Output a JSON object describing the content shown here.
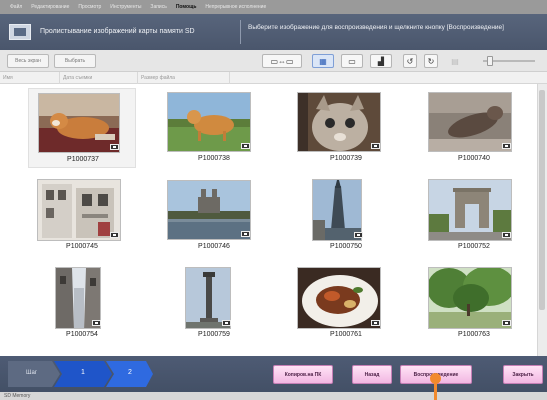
{
  "menu": {
    "items": [
      {
        "label": "Файл"
      },
      {
        "label": "Редактирование"
      },
      {
        "label": "Просмотр"
      },
      {
        "label": "Инструменты"
      },
      {
        "label": "Запись"
      },
      {
        "label": "Помощь",
        "active": true
      },
      {
        "label": "Непрерывное исполнение"
      }
    ]
  },
  "titlebar": {
    "title": "Пролистывание изображений карты памяти SD",
    "message": "Выберите изображение для воспроизведения и щелкните кнопку [Воспроизведение]"
  },
  "toolbar": {
    "left_buttons": [
      {
        "label": "Весь экран",
        "icon": "fullscreen"
      },
      {
        "label": "Выбрать",
        "icon": "select"
      }
    ],
    "view_icons": [
      {
        "icon": "copy-to-pc-icon",
        "glyph": "▭⇔▭"
      },
      {
        "icon": "thumbnail-view-icon",
        "glyph": "▦",
        "active": true
      },
      {
        "icon": "single-view-icon",
        "glyph": "▭"
      },
      {
        "icon": "multi-view-icon",
        "glyph": "▟"
      },
      {
        "icon": "rotate-left-icon",
        "glyph": "↺"
      },
      {
        "icon": "rotate-right-icon",
        "glyph": "↻"
      },
      {
        "icon": "folder-icon",
        "glyph": "▤"
      }
    ],
    "zoom": {
      "level": 0.1
    }
  },
  "columns": [
    {
      "label": "Имя"
    },
    {
      "label": "Дата съемки"
    },
    {
      "label": "Размер файла"
    }
  ],
  "thumbnails": [
    {
      "name": "P1000737",
      "selected": true
    },
    {
      "name": "P1000738"
    },
    {
      "name": "P1000739"
    },
    {
      "name": "P1000740"
    },
    {
      "name": "P1000745"
    },
    {
      "name": "P1000746"
    },
    {
      "name": "P1000750"
    },
    {
      "name": "P1000752"
    },
    {
      "name": "P1000754"
    },
    {
      "name": "P1000759"
    },
    {
      "name": "P1000761"
    },
    {
      "name": "P1000763"
    }
  ],
  "steps": [
    {
      "label": "Шаг"
    },
    {
      "label": "1"
    },
    {
      "label": "2"
    }
  ],
  "actions": {
    "copy_to_pc": "Копиров.на ПК",
    "back": "Назад",
    "play": "Воспроизведение",
    "close": "Закрыть"
  },
  "status": {
    "text": "SD Memory"
  },
  "colors": {
    "titlebar": "#4f5c74",
    "action_button": "#f4c1e8",
    "step_chevron": "#1f55c9",
    "cursor": "#f28a2d"
  }
}
